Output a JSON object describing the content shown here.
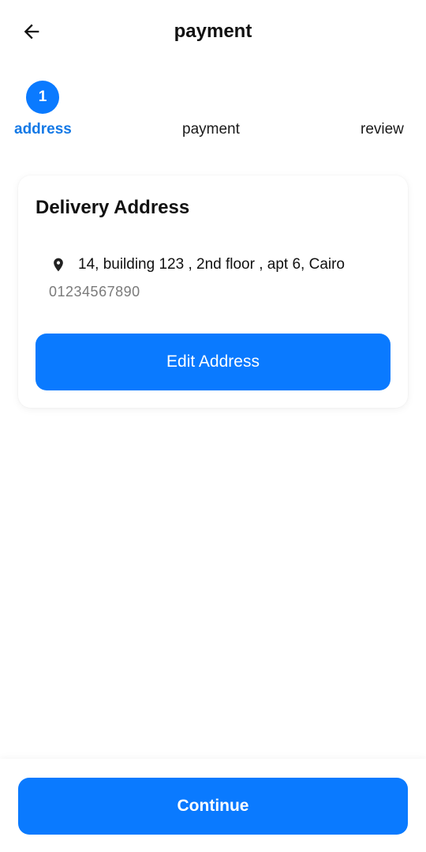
{
  "header": {
    "title": "payment",
    "back_icon": "arrow-left-icon"
  },
  "stepper": {
    "current_step_number": "1",
    "steps": [
      {
        "label": "address",
        "active": true
      },
      {
        "label": "payment",
        "active": false
      },
      {
        "label": "review",
        "active": false
      }
    ]
  },
  "address_card": {
    "title": "Delivery Address",
    "location_icon": "map-pin-icon",
    "address": "14, building 123 , 2nd floor , apt 6, Cairo",
    "phone": "01234567890",
    "edit_label": "Edit Address"
  },
  "footer": {
    "continue_label": "Continue"
  },
  "colors": {
    "primary": "#0A7AFF",
    "active_step_text": "#1479E6",
    "secondary_text": "#7a7a7a"
  }
}
